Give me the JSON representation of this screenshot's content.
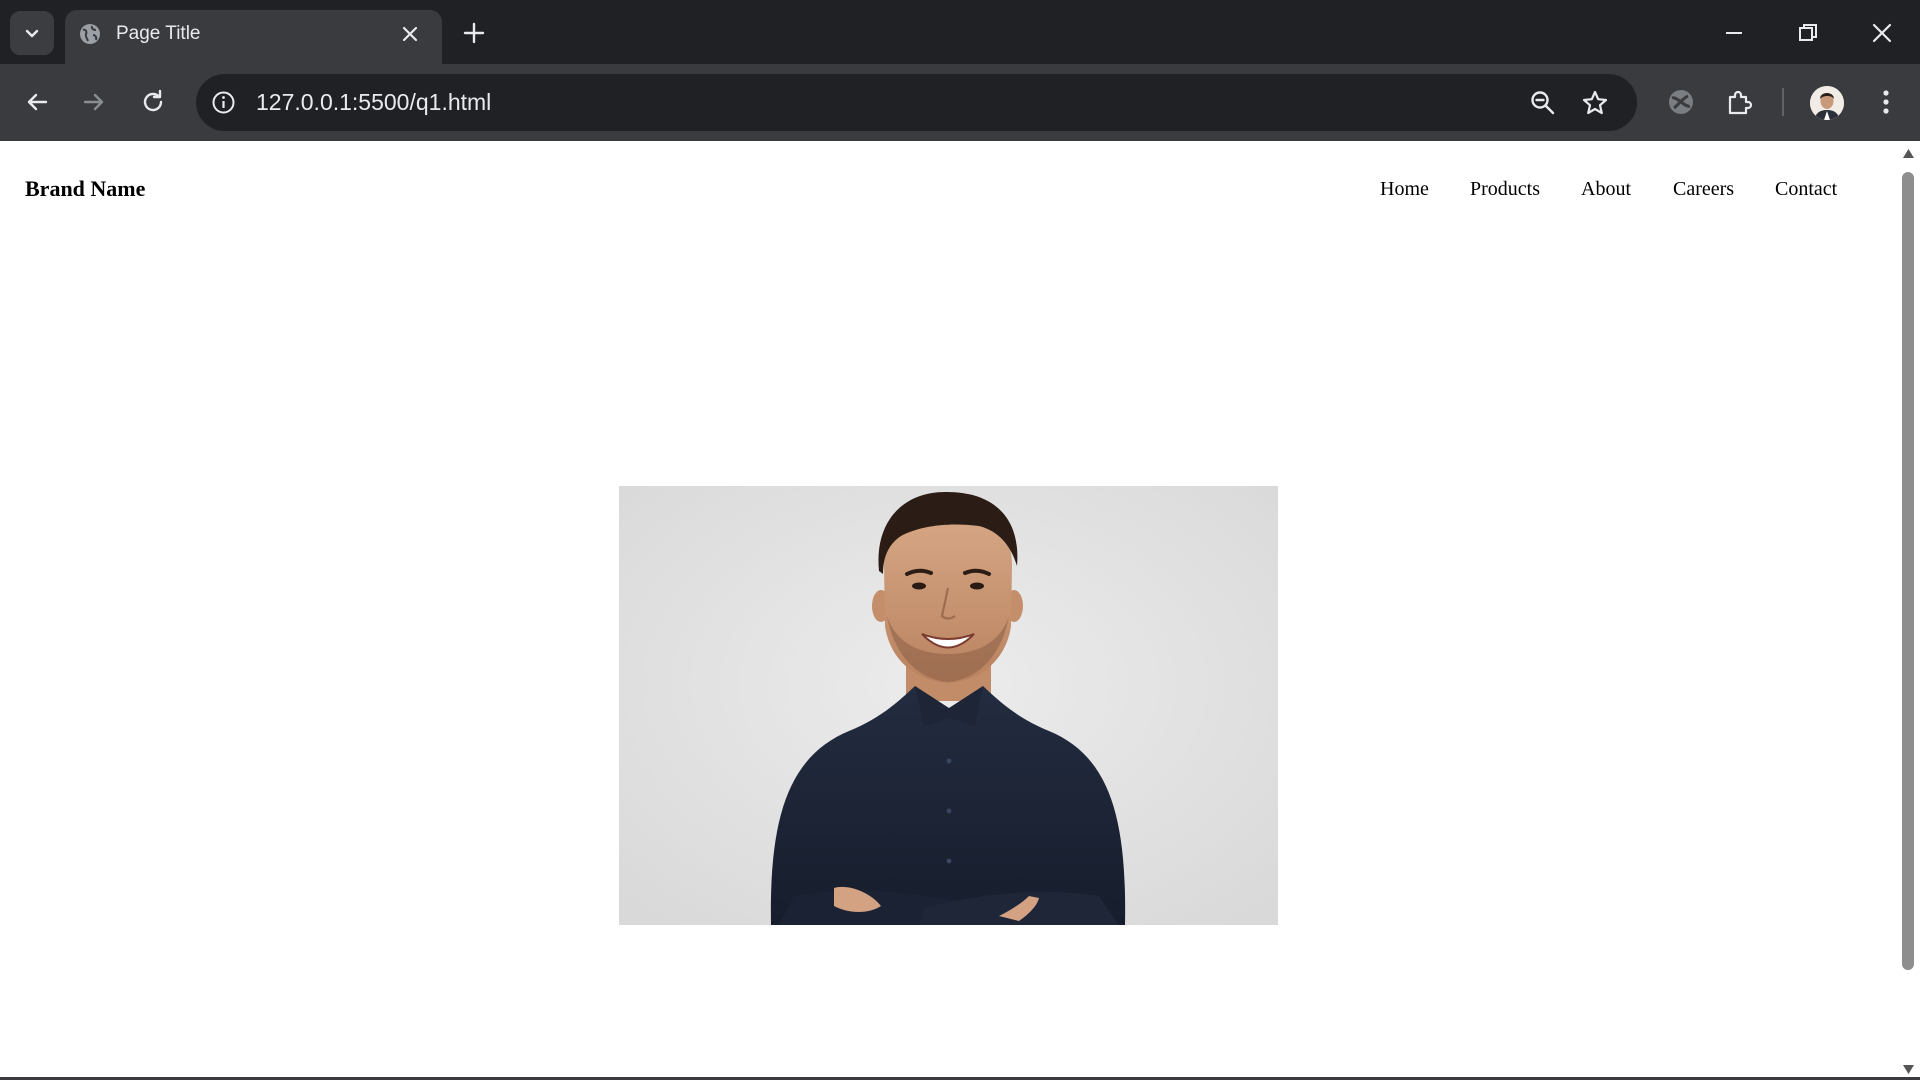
{
  "browser": {
    "tab": {
      "title": "Page Title"
    },
    "address_bar": {
      "url": "127.0.0.1:5500/q1.html"
    }
  },
  "page": {
    "brand": "Brand Name",
    "nav": [
      "Home",
      "Products",
      "About",
      "Careers",
      "Contact"
    ]
  },
  "colors": {
    "chrome_dark": "#202124",
    "chrome_toolbar": "#3a3b3e",
    "chrome_text": "#e8eaed",
    "page_background": "#ffffff",
    "shirt_navy": "#1c2437"
  },
  "icons": [
    "chevron-down-icon",
    "globe-icon",
    "close-icon",
    "plus-icon",
    "minimize-icon",
    "restore-icon",
    "back-arrow-icon",
    "forward-arrow-icon",
    "reload-icon",
    "info-icon",
    "zoom-icon",
    "star-icon",
    "extension-icon",
    "puzzle-icon",
    "avatar",
    "kebab-menu-icon"
  ]
}
